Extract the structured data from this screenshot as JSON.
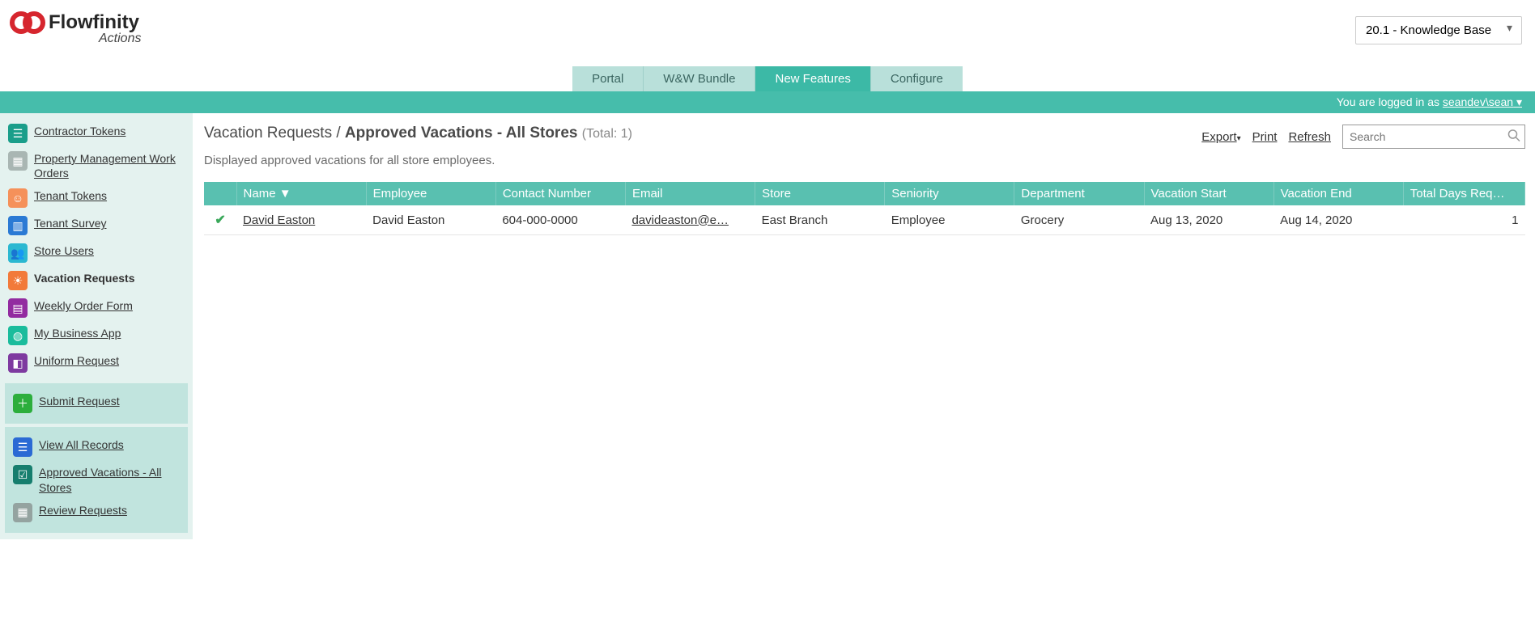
{
  "logo": {
    "name": "Flowfinity",
    "subtitle": "Actions"
  },
  "version_select": {
    "value": "20.1 - Knowledge Base"
  },
  "tabs": [
    {
      "label": "Portal",
      "active": false
    },
    {
      "label": "W&W Bundle",
      "active": false
    },
    {
      "label": "New Features",
      "active": true
    },
    {
      "label": "Configure",
      "active": false
    }
  ],
  "userbar": {
    "prefix": "You are logged in as ",
    "user": "seandev\\sean"
  },
  "sidebar": {
    "apps": [
      {
        "label": "Contractor Tokens"
      },
      {
        "label": "Property Management Work Orders"
      },
      {
        "label": "Tenant Tokens"
      },
      {
        "label": "Tenant Survey"
      },
      {
        "label": "Store Users"
      },
      {
        "label": "Vacation Requests",
        "active": true
      },
      {
        "label": "Weekly Order Form"
      },
      {
        "label": "My Business App"
      },
      {
        "label": "Uniform Request"
      }
    ],
    "submit": {
      "label": "Submit Request"
    },
    "views": [
      {
        "label": "View All Records"
      },
      {
        "label": "Approved Vacations - All Stores"
      },
      {
        "label": "Review Requests"
      }
    ]
  },
  "page": {
    "breadcrumb_root": "Vacation Requests",
    "breadcrumb_sep": " / ",
    "breadcrumb_current": "Approved Vacations - All Stores",
    "total_label": "(Total: 1)",
    "description": "Displayed approved vacations for all store employees."
  },
  "actions": {
    "export": "Export",
    "print": "Print",
    "refresh": "Refresh",
    "search_placeholder": "Search"
  },
  "table": {
    "headers": {
      "check": "",
      "name": "Name ▼",
      "employee": "Employee",
      "contact": "Contact Number",
      "email": "Email",
      "store": "Store",
      "seniority": "Seniority",
      "department": "Department",
      "vstart": "Vacation Start",
      "vend": "Vacation End",
      "days": "Total Days Req…"
    },
    "rows": [
      {
        "approved": true,
        "name": "David Easton",
        "employee": "David Easton",
        "contact": "604-000-0000",
        "email": "davideaston@e…",
        "store": "East Branch",
        "seniority": "Employee",
        "department": "Grocery",
        "vstart": "Aug 13, 2020",
        "vend": "Aug 14, 2020",
        "days": "1"
      }
    ]
  }
}
